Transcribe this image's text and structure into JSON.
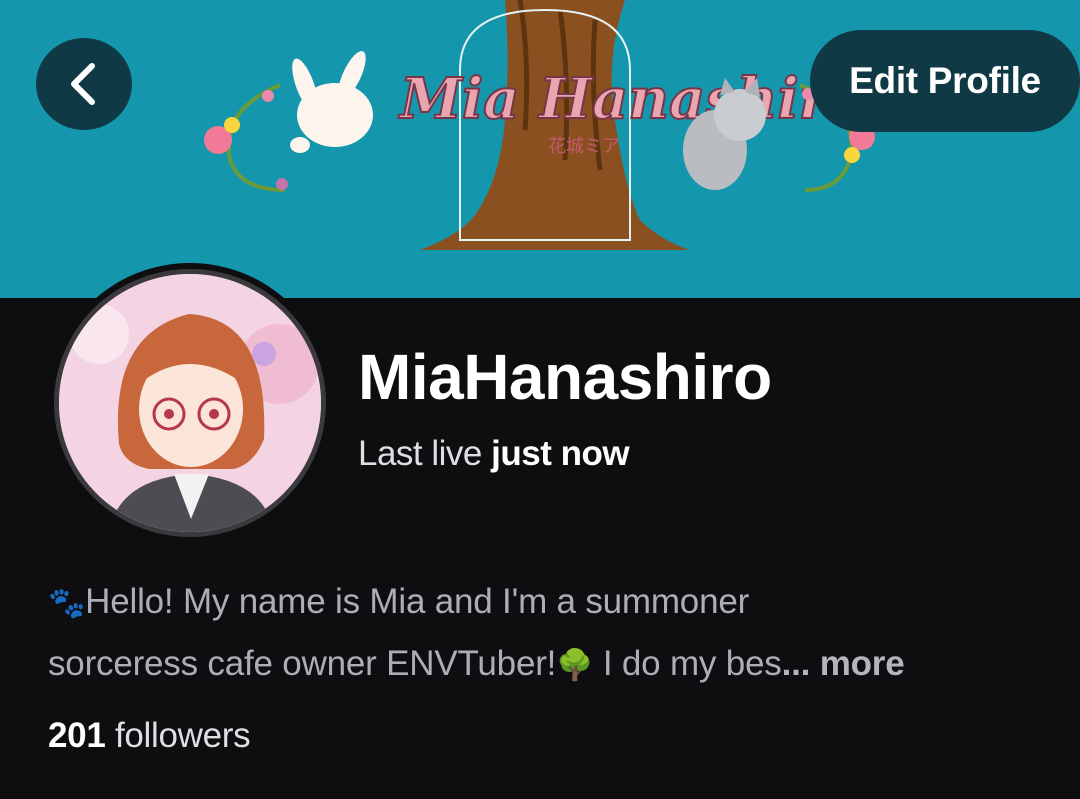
{
  "header": {
    "back_icon": "chevron-left-icon",
    "edit_profile_label": "Edit Profile",
    "banner_logo_text": "Mia Hanashiro",
    "banner_logo_subtext": "花城ミア"
  },
  "profile": {
    "channel_name": "MiaHanashiro",
    "last_live_prefix": "Last live",
    "last_live_value": "just now",
    "bio_icon_1": "🐾",
    "bio_line_1": "Hello! My name is Mia and I'm a summoner",
    "bio_line_2": "sorceress cafe owner ENVTuber!",
    "bio_icon_2": "🌳",
    "bio_line_2_tail": " I do my bes",
    "bio_ellipsis": "...",
    "bio_more_label": "more",
    "followers_count": "201",
    "followers_label": "followers"
  },
  "colors": {
    "banner_bg": "#1497ad",
    "page_bg": "#0e0e10",
    "button_bg": "#0f3a45",
    "text_primary": "#ffffff",
    "text_secondary": "#adadb8"
  }
}
